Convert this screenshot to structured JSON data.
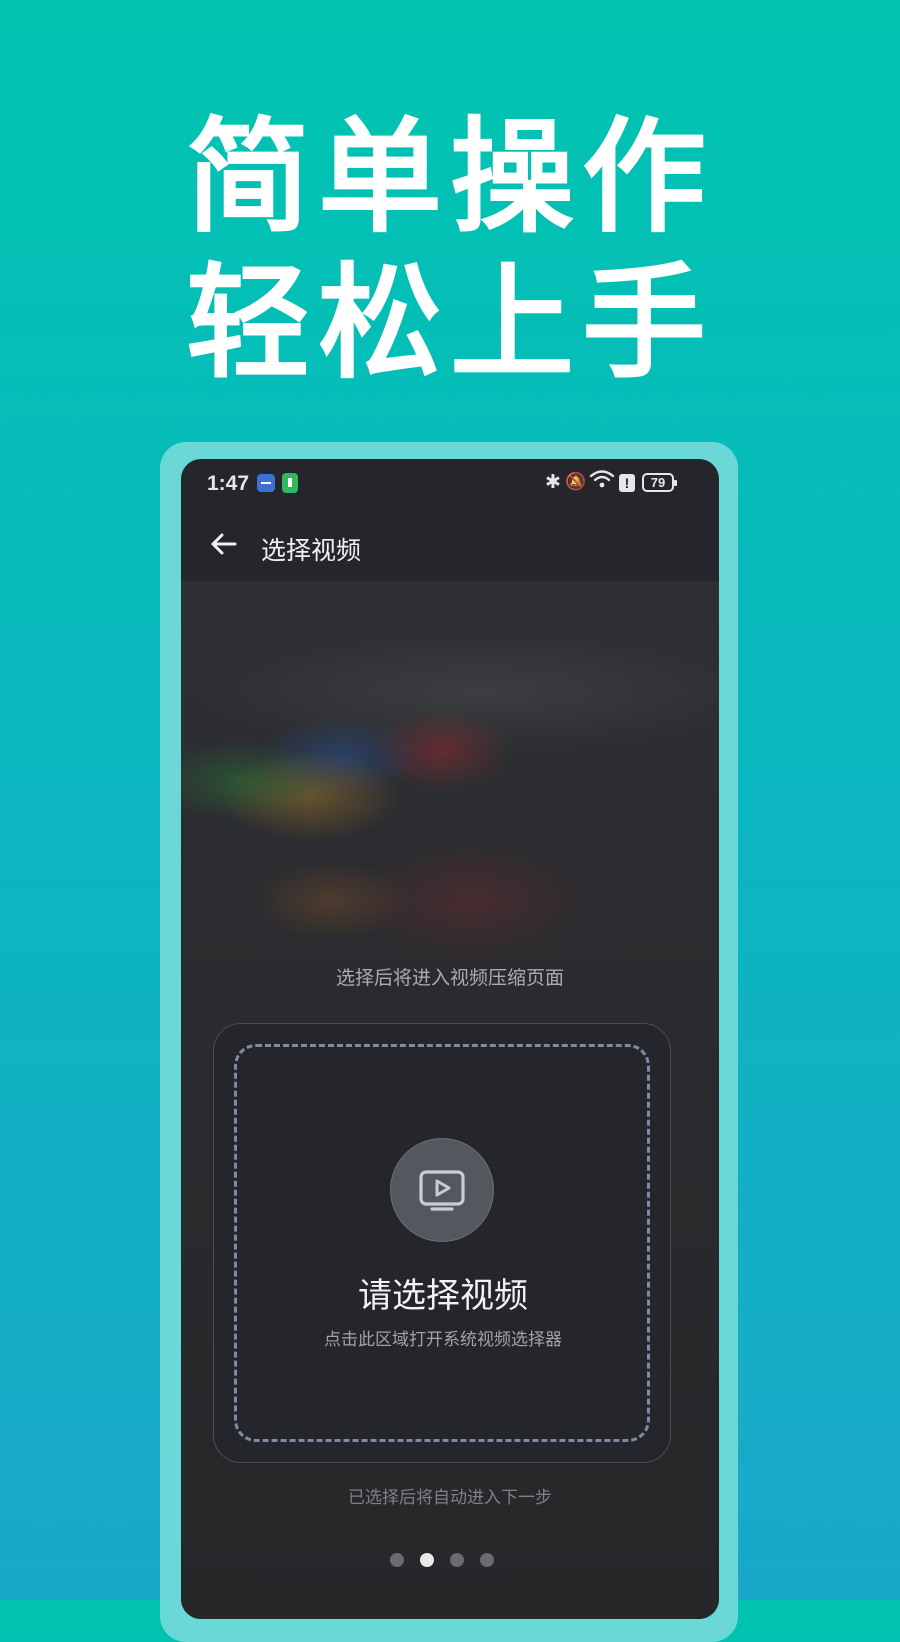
{
  "headline": {
    "line1": "简单操作",
    "line2": "轻松上手"
  },
  "status_bar": {
    "time": "1:47",
    "battery": "79",
    "icons": [
      "usb-icon",
      "battery-saver-icon",
      "bluetooth-icon",
      "mute-icon",
      "wifi-icon",
      "alert-icon",
      "battery-icon"
    ]
  },
  "app_bar": {
    "title": "选择视频",
    "back_icon": "arrow-left-icon"
  },
  "main": {
    "hint_top": "选择后将进入视频压缩页面",
    "picker": {
      "title": "请选择视频",
      "subtitle": "点击此区域打开系统视频选择器",
      "icon": "video-play-icon"
    },
    "hint_bottom": "已选择后将自动进入下一步",
    "pagination": {
      "total": 4,
      "active_index": 1
    }
  },
  "colors": {
    "background_top": "#00c4b0",
    "background_bottom": "#1aa8c9",
    "phone_frame": "#6ad8d6",
    "screen_bg": "#24262b",
    "dashed_border": "#7d8aa0"
  }
}
